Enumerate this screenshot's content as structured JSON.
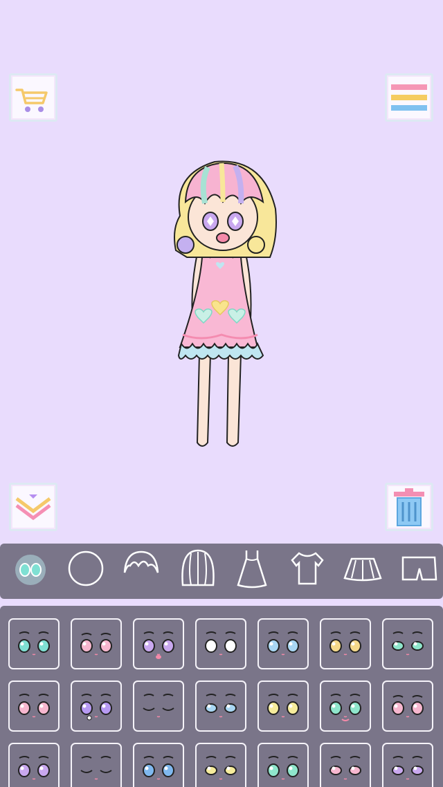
{
  "toolbar": {
    "shop_icon": "shopping-cart-icon",
    "menu_icon": "menu-icon",
    "hide_panel_icon": "double-chevron-down-icon",
    "trash_icon": "trash-can-icon"
  },
  "category_tabs": [
    {
      "id": "face",
      "icon": "face-eyes-icon",
      "selected": true
    },
    {
      "id": "head",
      "icon": "head-shape-icon"
    },
    {
      "id": "bangs",
      "icon": "bangs-hair-icon"
    },
    {
      "id": "hair",
      "icon": "back-hair-icon"
    },
    {
      "id": "dress",
      "icon": "dress-icon"
    },
    {
      "id": "top",
      "icon": "tshirt-icon"
    },
    {
      "id": "skirt",
      "icon": "skirt-icon"
    },
    {
      "id": "bottom",
      "icon": "shorts-icon"
    }
  ],
  "eye_options": [
    {
      "iris": "#7fe0d3",
      "mood": "neutral"
    },
    {
      "iris": "#f7b7cf",
      "mood": "sad"
    },
    {
      "iris": "#c9a8ef",
      "mood": "surprised"
    },
    {
      "iris": "#ffffff",
      "mood": "blank"
    },
    {
      "iris": "#a9d7f3",
      "mood": "neutral"
    },
    {
      "iris": "#f5d98b",
      "mood": "sparkle"
    },
    {
      "iris": "#8fe6cc",
      "mood": "half"
    },
    {
      "iris": "#f7b7cf",
      "mood": "neutral"
    },
    {
      "iris": "#b79af2",
      "mood": "crying"
    },
    {
      "iris": "#000000",
      "mood": "closed"
    },
    {
      "iris": "#a9d7f3",
      "mood": "bored"
    },
    {
      "iris": "#f6ec9c",
      "mood": "neutral"
    },
    {
      "iris": "#8fe6cc",
      "mood": "happy"
    },
    {
      "iris": "#f7b7cf",
      "mood": "worried"
    },
    {
      "iris": "#c9a8ef",
      "mood": "neutral"
    },
    {
      "iris": "#000000",
      "mood": "sleepy"
    },
    {
      "iris": "#7fb8ef",
      "mood": "sparkle"
    },
    {
      "iris": "#f6ec9c",
      "mood": "half"
    },
    {
      "iris": "#8fe6cc",
      "mood": "angry"
    },
    {
      "iris": "#f7b7cf",
      "mood": "half"
    },
    {
      "iris": "#c9a8ef",
      "mood": "half"
    }
  ],
  "colors": {
    "background": "#e9dcfd",
    "panel": "#7a7589",
    "outline": "#f6f4fa"
  }
}
